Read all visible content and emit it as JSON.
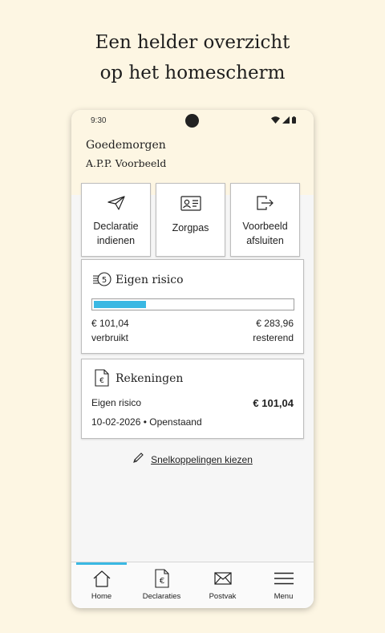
{
  "promo": {
    "line1": "Een helder overzicht",
    "line2": "op het homescherm"
  },
  "status_bar": {
    "time": "9:30"
  },
  "header": {
    "greeting": "Goedemorgen",
    "username": "A.P.P. Voorbeeld"
  },
  "tiles": [
    {
      "label": "Declaratie\nindienen",
      "icon": "paper-plane-icon"
    },
    {
      "label": "Zorgpas",
      "icon": "id-card-icon"
    },
    {
      "label": "Voorbeeld\nafsluiten",
      "icon": "exit-icon"
    }
  ],
  "eigen_risico": {
    "title": "Eigen risico",
    "icon": "coins-5-icon",
    "icon_digit": "5",
    "used_amount": "€ 101,04",
    "used_label": "verbruikt",
    "remaining_amount": "€ 283,96",
    "remaining_label": "resterend",
    "progress_fraction": 0.263,
    "progress_color": "#3ab8e3"
  },
  "rekeningen": {
    "title": "Rekeningen",
    "icon": "euro-document-icon",
    "item_name": "Eigen risico",
    "item_amount": "€ 101,04",
    "item_meta": "10-02-2026 • Openstaand"
  },
  "shortcut": {
    "label": "Snelkoppelingen kiezen",
    "icon": "pencil-icon"
  },
  "nav": {
    "active_color": "#3ab8e3",
    "items": [
      {
        "label": "Home",
        "icon": "home-icon",
        "active": true
      },
      {
        "label": "Declaraties",
        "icon": "euro-document-icon",
        "active": false
      },
      {
        "label": "Postvak",
        "icon": "envelope-icon",
        "active": false
      },
      {
        "label": "Menu",
        "icon": "hamburger-menu-icon",
        "active": false
      }
    ]
  }
}
